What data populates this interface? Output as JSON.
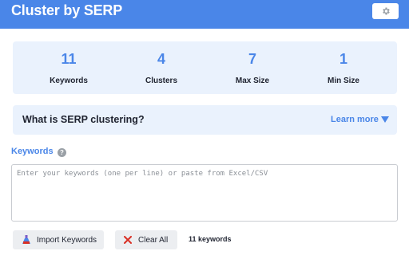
{
  "header": {
    "title": "Cluster by SERP",
    "settings_icon": "gear-icon"
  },
  "stats": [
    {
      "value": "11",
      "label": "Keywords"
    },
    {
      "value": "4",
      "label": "Clusters"
    },
    {
      "value": "7",
      "label": "Max Size"
    },
    {
      "value": "1",
      "label": "Min Size"
    }
  ],
  "serp_info": {
    "question": "What is SERP clustering?",
    "learn_more": "Learn more",
    "learn_more_icon": "triangle-down-icon"
  },
  "keywords": {
    "label": "Keywords",
    "help_icon": "question-icon",
    "help_glyph": "?",
    "placeholder": "Enter your keywords (one per line) or paste from Excel/CSV",
    "value": ""
  },
  "actions": {
    "import_label": "Import Keywords",
    "import_icon": "flask-icon",
    "clear_label": "Clear All",
    "clear_icon": "close-icon",
    "count_text": "11 keywords"
  },
  "colors": {
    "accent": "#4a86e8",
    "panel": "#eaf2fd",
    "clear_red": "#d93025"
  }
}
